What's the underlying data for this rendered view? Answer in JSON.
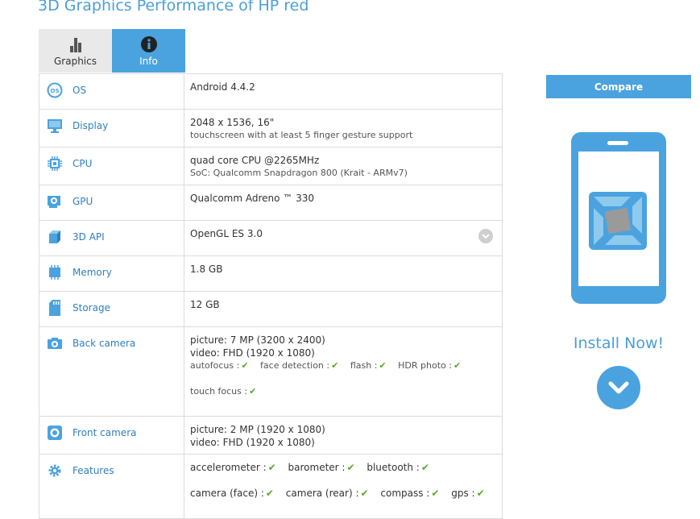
{
  "page": {
    "title": "3D Graphics Performance of HP red"
  },
  "tabs": [
    {
      "label": "Graphics",
      "icon": "bar-chart-icon",
      "active": false
    },
    {
      "label": "Info",
      "icon": "info-icon",
      "active": true
    }
  ],
  "specs": {
    "os": {
      "label": "OS",
      "icon": "os-icon",
      "value": "Android 4.4.2"
    },
    "display": {
      "label": "Display",
      "icon": "monitor-icon",
      "value": "2048 x 1536, 16\"",
      "sub": "touchscreen with at least 5 finger gesture support"
    },
    "cpu": {
      "label": "CPU",
      "icon": "cpu-chip-icon",
      "value": "quad core CPU @2265MHz",
      "sub": "SoC: Qualcomm Snapdragon 800 (Krait - ARMv7)"
    },
    "gpu": {
      "label": "GPU",
      "icon": "gpu-card-icon",
      "value": "Qualcomm Adreno ™ 330"
    },
    "api": {
      "label": "3D API",
      "icon": "cube-icon",
      "value": "OpenGL ES 3.0"
    },
    "memory": {
      "label": "Memory",
      "icon": "memory-chip-icon",
      "value": "1.8 GB"
    },
    "storage": {
      "label": "Storage",
      "icon": "sd-card-icon",
      "value": "12 GB"
    },
    "back_camera": {
      "label": "Back camera",
      "icon": "camera-icon",
      "picture": "picture: 7 MP (3200 x 2400)",
      "video": "video: FHD (1920 x 1080)",
      "features": [
        "autofocus :",
        "face detection :",
        "flash :",
        "HDR photo :"
      ],
      "extra": "touch focus :"
    },
    "front_camera": {
      "label": "Front camera",
      "icon": "front-camera-icon",
      "picture": "picture: 2 MP (1920 x 1080)",
      "video": "video: FHD (1920 x 1080)"
    },
    "features": {
      "label": "Features",
      "icon": "gear-icon",
      "row1": [
        "accelerometer :",
        "barometer :",
        "bluetooth :"
      ],
      "row2": [
        "camera (face) :",
        "camera (rear) :",
        "compass :",
        "gps :"
      ]
    }
  },
  "sidebar": {
    "compare_label": "Compare",
    "install_label": "Install Now!"
  },
  "colors": {
    "accent": "#4aa3df",
    "check": "#5aa826",
    "label": "#2f7fc0"
  }
}
